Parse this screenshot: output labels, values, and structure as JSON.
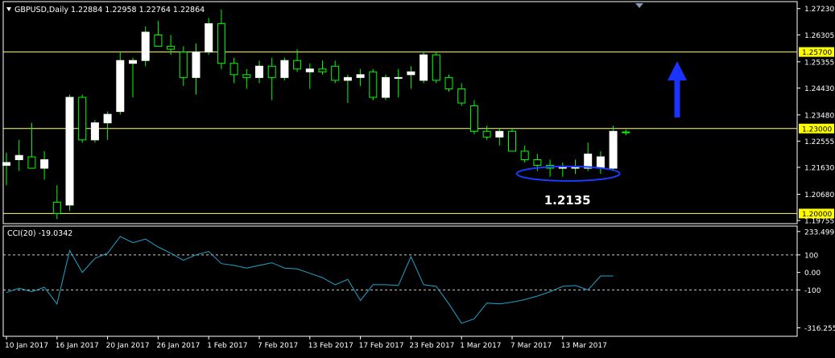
{
  "header": {
    "symbol_line": "GBPUSD,Daily  1.22884 1.22958 1.22764 1.22864",
    "indicator_line": "CCI(20) -19.0342"
  },
  "annotation": {
    "support_text": "1.2135"
  },
  "colors": {
    "background": "#000000",
    "frame": "#ffffff",
    "bull_candle": "#ffffff",
    "bear_candle": "#000000",
    "wick": "#00ff00",
    "level_line": "#ffff66",
    "level_label_bg": "#ffff00",
    "cci_line": "#1fa3c9",
    "ellipse": "#1a3cff",
    "arrow": "#1a33ff"
  },
  "chart_data": [
    {
      "type": "candlestick",
      "title": "GBPUSD,Daily",
      "ohlc_readout": [
        1.22884,
        1.22958,
        1.22764,
        1.22864
      ],
      "ylim": [
        1.197,
        1.2745
      ],
      "y_ticks": [
        1.2723,
        1.26305,
        1.25355,
        1.2443,
        1.2348,
        1.22555,
        1.2163,
        1.2068,
        1.19755
      ],
      "x_labels": [
        "10 Jan 2017",
        "16 Jan 2017",
        "20 Jan 2017",
        "26 Jan 2017",
        "1 Feb 2017",
        "7 Feb 2017",
        "13 Feb 2017",
        "17 Feb 2017",
        "23 Feb 2017",
        "1 Mar 2017",
        "7 Mar 2017",
        "13 Mar 2017"
      ],
      "x_label_bar_index": [
        0,
        4,
        8,
        12,
        16,
        20,
        24,
        28,
        32,
        36,
        40,
        44
      ],
      "horizontal_levels": [
        {
          "value": 1.257,
          "label": "1.25700"
        },
        {
          "value": 1.23,
          "label": "1.23000"
        },
        {
          "value": 1.2,
          "label": "1.20000"
        }
      ],
      "support_level": 1.2135,
      "candles": [
        {
          "o": 1.217,
          "h": 1.2215,
          "l": 1.21,
          "c": 1.218
        },
        {
          "o": 1.219,
          "h": 1.226,
          "l": 1.215,
          "c": 1.2205
        },
        {
          "o": 1.22,
          "h": 1.232,
          "l": 1.216,
          "c": 1.216
        },
        {
          "o": 1.216,
          "h": 1.222,
          "l": 1.212,
          "c": 1.219
        },
        {
          "o": 1.204,
          "h": 1.21,
          "l": 1.198,
          "c": 1.2
        },
        {
          "o": 1.203,
          "h": 1.242,
          "l": 1.201,
          "c": 1.241
        },
        {
          "o": 1.241,
          "h": 1.242,
          "l": 1.225,
          "c": 1.226
        },
        {
          "o": 1.226,
          "h": 1.233,
          "l": 1.225,
          "c": 1.232
        },
        {
          "o": 1.232,
          "h": 1.236,
          "l": 1.226,
          "c": 1.235
        },
        {
          "o": 1.236,
          "h": 1.257,
          "l": 1.235,
          "c": 1.254
        },
        {
          "o": 1.253,
          "h": 1.255,
          "l": 1.241,
          "c": 1.254
        },
        {
          "o": 1.254,
          "h": 1.266,
          "l": 1.252,
          "c": 1.264
        },
        {
          "o": 1.263,
          "h": 1.268,
          "l": 1.259,
          "c": 1.259
        },
        {
          "o": 1.259,
          "h": 1.263,
          "l": 1.256,
          "c": 1.258
        },
        {
          "o": 1.257,
          "h": 1.259,
          "l": 1.245,
          "c": 1.248
        },
        {
          "o": 1.248,
          "h": 1.26,
          "l": 1.242,
          "c": 1.257
        },
        {
          "o": 1.257,
          "h": 1.269,
          "l": 1.256,
          "c": 1.267
        },
        {
          "o": 1.267,
          "h": 1.272,
          "l": 1.251,
          "c": 1.253
        },
        {
          "o": 1.253,
          "h": 1.255,
          "l": 1.246,
          "c": 1.249
        },
        {
          "o": 1.249,
          "h": 1.251,
          "l": 1.244,
          "c": 1.248
        },
        {
          "o": 1.248,
          "h": 1.254,
          "l": 1.246,
          "c": 1.252
        },
        {
          "o": 1.252,
          "h": 1.255,
          "l": 1.24,
          "c": 1.248
        },
        {
          "o": 1.248,
          "h": 1.255,
          "l": 1.247,
          "c": 1.254
        },
        {
          "o": 1.254,
          "h": 1.258,
          "l": 1.25,
          "c": 1.251
        },
        {
          "o": 1.25,
          "h": 1.253,
          "l": 1.244,
          "c": 1.251
        },
        {
          "o": 1.251,
          "h": 1.254,
          "l": 1.249,
          "c": 1.25
        },
        {
          "o": 1.252,
          "h": 1.254,
          "l": 1.246,
          "c": 1.247
        },
        {
          "o": 1.247,
          "h": 1.249,
          "l": 1.239,
          "c": 1.248
        },
        {
          "o": 1.248,
          "h": 1.251,
          "l": 1.245,
          "c": 1.249
        },
        {
          "o": 1.25,
          "h": 1.251,
          "l": 1.24,
          "c": 1.241
        },
        {
          "o": 1.241,
          "h": 1.249,
          "l": 1.24,
          "c": 1.248
        },
        {
          "o": 1.248,
          "h": 1.251,
          "l": 1.241,
          "c": 1.248
        },
        {
          "o": 1.249,
          "h": 1.252,
          "l": 1.244,
          "c": 1.25
        },
        {
          "o": 1.247,
          "h": 1.257,
          "l": 1.246,
          "c": 1.256
        },
        {
          "o": 1.256,
          "h": 1.257,
          "l": 1.246,
          "c": 1.247
        },
        {
          "o": 1.248,
          "h": 1.249,
          "l": 1.243,
          "c": 1.244
        },
        {
          "o": 1.244,
          "h": 1.246,
          "l": 1.238,
          "c": 1.239
        },
        {
          "o": 1.238,
          "h": 1.24,
          "l": 1.228,
          "c": 1.229
        },
        {
          "o": 1.229,
          "h": 1.231,
          "l": 1.226,
          "c": 1.227
        },
        {
          "o": 1.227,
          "h": 1.23,
          "l": 1.224,
          "c": 1.229
        },
        {
          "o": 1.229,
          "h": 1.23,
          "l": 1.222,
          "c": 1.222
        },
        {
          "o": 1.222,
          "h": 1.224,
          "l": 1.218,
          "c": 1.219
        },
        {
          "o": 1.219,
          "h": 1.221,
          "l": 1.215,
          "c": 1.217
        },
        {
          "o": 1.217,
          "h": 1.219,
          "l": 1.213,
          "c": 1.216
        },
        {
          "o": 1.216,
          "h": 1.218,
          "l": 1.213,
          "c": 1.2165
        },
        {
          "o": 1.216,
          "h": 1.219,
          "l": 1.214,
          "c": 1.2165
        },
        {
          "o": 1.216,
          "h": 1.225,
          "l": 1.215,
          "c": 1.221
        },
        {
          "o": 1.216,
          "h": 1.222,
          "l": 1.214,
          "c": 1.22
        },
        {
          "o": 1.216,
          "h": 1.231,
          "l": 1.215,
          "c": 1.229
        },
        {
          "o": 1.2288,
          "h": 1.2296,
          "l": 1.2276,
          "c": 1.2286
        }
      ]
    },
    {
      "type": "line",
      "title": "CCI(20) -19.0342",
      "name": "CCI(20)",
      "ylim": [
        -360,
        260
      ],
      "y_ticks": [
        {
          "value": 233.499,
          "label": "233.499"
        },
        {
          "value": 100,
          "label": "100"
        },
        {
          "value": 0,
          "label": "0.00"
        },
        {
          "value": -100,
          "label": "-100"
        },
        {
          "value": -316.2554,
          "label": "-316.2554"
        }
      ],
      "dashed_levels": [
        100,
        -100
      ],
      "values": [
        -115,
        -90,
        -110,
        -85,
        -180,
        125,
        0,
        80,
        110,
        205,
        170,
        190,
        145,
        110,
        70,
        100,
        120,
        50,
        40,
        25,
        40,
        55,
        25,
        20,
        -5,
        -30,
        -70,
        -40,
        -160,
        -70,
        -70,
        -75,
        90,
        -70,
        -80,
        -180,
        -290,
        -265,
        -175,
        -180,
        -170,
        -155,
        -135,
        -110,
        -80,
        -75,
        -100,
        -20,
        -20
      ]
    }
  ]
}
